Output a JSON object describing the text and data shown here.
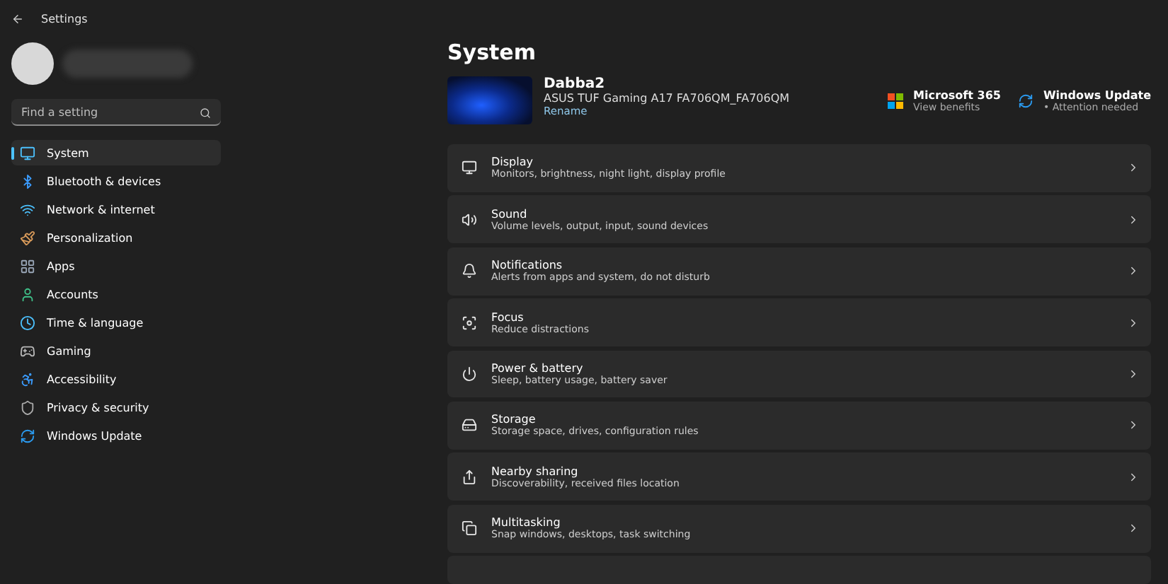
{
  "window": {
    "title": "Settings"
  },
  "search": {
    "placeholder": "Find a setting"
  },
  "sidebar": {
    "items": [
      {
        "label": "System",
        "selected": true
      },
      {
        "label": "Bluetooth & devices",
        "selected": false
      },
      {
        "label": "Network & internet",
        "selected": false
      },
      {
        "label": "Personalization",
        "selected": false
      },
      {
        "label": "Apps",
        "selected": false
      },
      {
        "label": "Accounts",
        "selected": false
      },
      {
        "label": "Time & language",
        "selected": false
      },
      {
        "label": "Gaming",
        "selected": false
      },
      {
        "label": "Accessibility",
        "selected": false
      },
      {
        "label": "Privacy & security",
        "selected": false
      },
      {
        "label": "Windows Update",
        "selected": false
      }
    ]
  },
  "page": {
    "title": "System"
  },
  "device": {
    "name": "Dabba2",
    "model": "ASUS TUF Gaming A17 FA706QM_FA706QM",
    "rename": "Rename"
  },
  "promos": [
    {
      "title": "Microsoft 365",
      "subtitle": "View benefits"
    },
    {
      "title": "Windows Update",
      "subtitle": "• Attention needed"
    }
  ],
  "settings": [
    {
      "title": "Display",
      "subtitle": "Monitors, brightness, night light, display profile"
    },
    {
      "title": "Sound",
      "subtitle": "Volume levels, output, input, sound devices"
    },
    {
      "title": "Notifications",
      "subtitle": "Alerts from apps and system, do not disturb"
    },
    {
      "title": "Focus",
      "subtitle": "Reduce distractions"
    },
    {
      "title": "Power & battery",
      "subtitle": "Sleep, battery usage, battery saver"
    },
    {
      "title": "Storage",
      "subtitle": "Storage space, drives, configuration rules"
    },
    {
      "title": "Nearby sharing",
      "subtitle": "Discoverability, received files location"
    },
    {
      "title": "Multitasking",
      "subtitle": "Snap windows, desktops, task switching"
    }
  ]
}
